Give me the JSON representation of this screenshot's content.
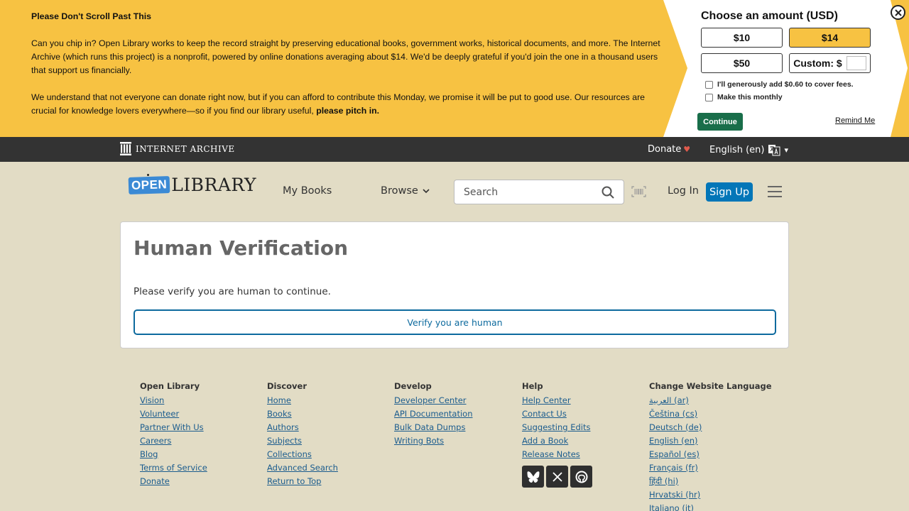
{
  "banner": {
    "title": "Please Don't Scroll Past This",
    "para1": "Can you chip in? Open Library works to keep the record straight by preserving educational books, government works, historical documents, and more. The Internet Archive (which runs this project) is a nonprofit, powered by online donations averaging about $14. We'd be deeply grateful if you'd join the one in a thousand users that support us financially.",
    "para2_prefix": "We understand that not everyone can donate right now, but if you can afford to contribute this Monday, we promise it will be put to good use. Our resources are crucial for knowledge lovers everywhere—so if you find our library useful, ",
    "para2_bold": "please pitch in.",
    "amount_title": "Choose an amount (USD)",
    "amounts": [
      "$10",
      "$14",
      "$50"
    ],
    "custom_label": "Custom: $",
    "cover_fees": "I'll generously add $0.60 to cover fees.",
    "monthly": "Make this monthly",
    "continue": "Continue",
    "remind": "Remind Me"
  },
  "iabar": {
    "logo_text": "INTERNET ARCHIVE",
    "donate": "Donate",
    "heart": "♥",
    "language": "English (en)",
    "caret": "▾"
  },
  "header": {
    "logo_open": "OPEN",
    "logo_library": "LIBRARY",
    "my_books": "My Books",
    "browse": "Browse",
    "search_placeholder": "Search",
    "login": "Log In",
    "signup": "Sign Up"
  },
  "main": {
    "title": "Human Verification",
    "message": "Please verify you are human to continue.",
    "verify_button": "Verify you are human"
  },
  "footer": {
    "columns": [
      {
        "heading": "Open Library",
        "links": [
          "Vision",
          "Volunteer",
          "Partner With Us",
          "Careers",
          "Blog",
          "Terms of Service",
          "Donate"
        ]
      },
      {
        "heading": "Discover",
        "links": [
          "Home",
          "Books",
          "Authors",
          "Subjects",
          "Collections",
          "Advanced Search",
          "Return to Top"
        ]
      },
      {
        "heading": "Develop",
        "links": [
          "Developer Center",
          "API Documentation",
          "Bulk Data Dumps",
          "Writing Bots"
        ]
      },
      {
        "heading": "Help",
        "links": [
          "Help Center",
          "Contact Us",
          "Suggesting Edits",
          "Add a Book",
          "Release Notes"
        ]
      },
      {
        "heading": "Change Website Language",
        "links": [
          "العربية (ar)",
          "Čeština (cs)",
          "Deutsch (de)",
          "English (en)",
          "Español (es)",
          "Français (fr)",
          "हिंदी (hi)",
          "Hrvatski (hr)",
          "Italiano (it)"
        ]
      }
    ],
    "social_icons": [
      "bluesky-icon",
      "x-icon",
      "github-icon"
    ]
  }
}
